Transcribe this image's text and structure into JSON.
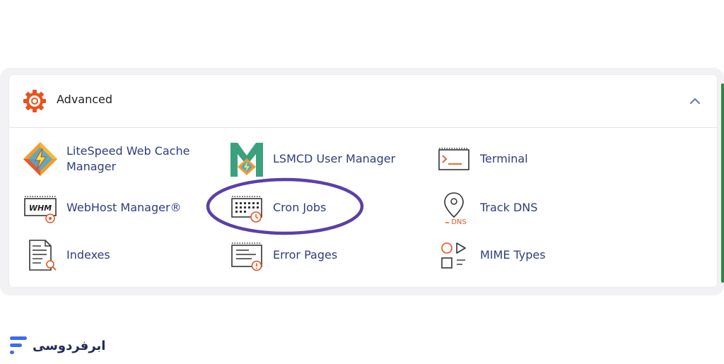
{
  "section": {
    "title": "Advanced",
    "accent_color": "#e8531d",
    "text_color": "#2d3e7e"
  },
  "items": [
    {
      "key": "litespeed",
      "label_line1": "LiteSpeed Web Cache",
      "label_line2": "Manager",
      "icon": "litespeed-icon"
    },
    {
      "key": "lsmcd",
      "label_line1": "LSMCD User Manager",
      "icon": "lsmcd-icon"
    },
    {
      "key": "terminal",
      "label_line1": "Terminal",
      "icon": "terminal-icon"
    },
    {
      "key": "whm",
      "label_line1": "WebHost Manager®",
      "icon": "whm-icon",
      "icon_text": "WHM"
    },
    {
      "key": "cron",
      "label_line1": "Cron Jobs",
      "icon": "cron-calendar-icon"
    },
    {
      "key": "trackdns",
      "label_line1": "Track DNS",
      "icon": "track-dns-icon",
      "icon_text": "DNS"
    },
    {
      "key": "indexes",
      "label_line1": "Indexes",
      "icon": "indexes-icon"
    },
    {
      "key": "errorpages",
      "label_line1": "Error Pages",
      "icon": "error-pages-icon"
    },
    {
      "key": "mime",
      "label_line1": "MIME Types",
      "icon": "mime-types-icon"
    }
  ],
  "highlight": {
    "color": "#5b3fa8",
    "target": "Cron Jobs"
  },
  "brand": {
    "name": "ابرفردوسی",
    "color": "#1f2a5a",
    "logo_color": "#3e6bf0"
  }
}
